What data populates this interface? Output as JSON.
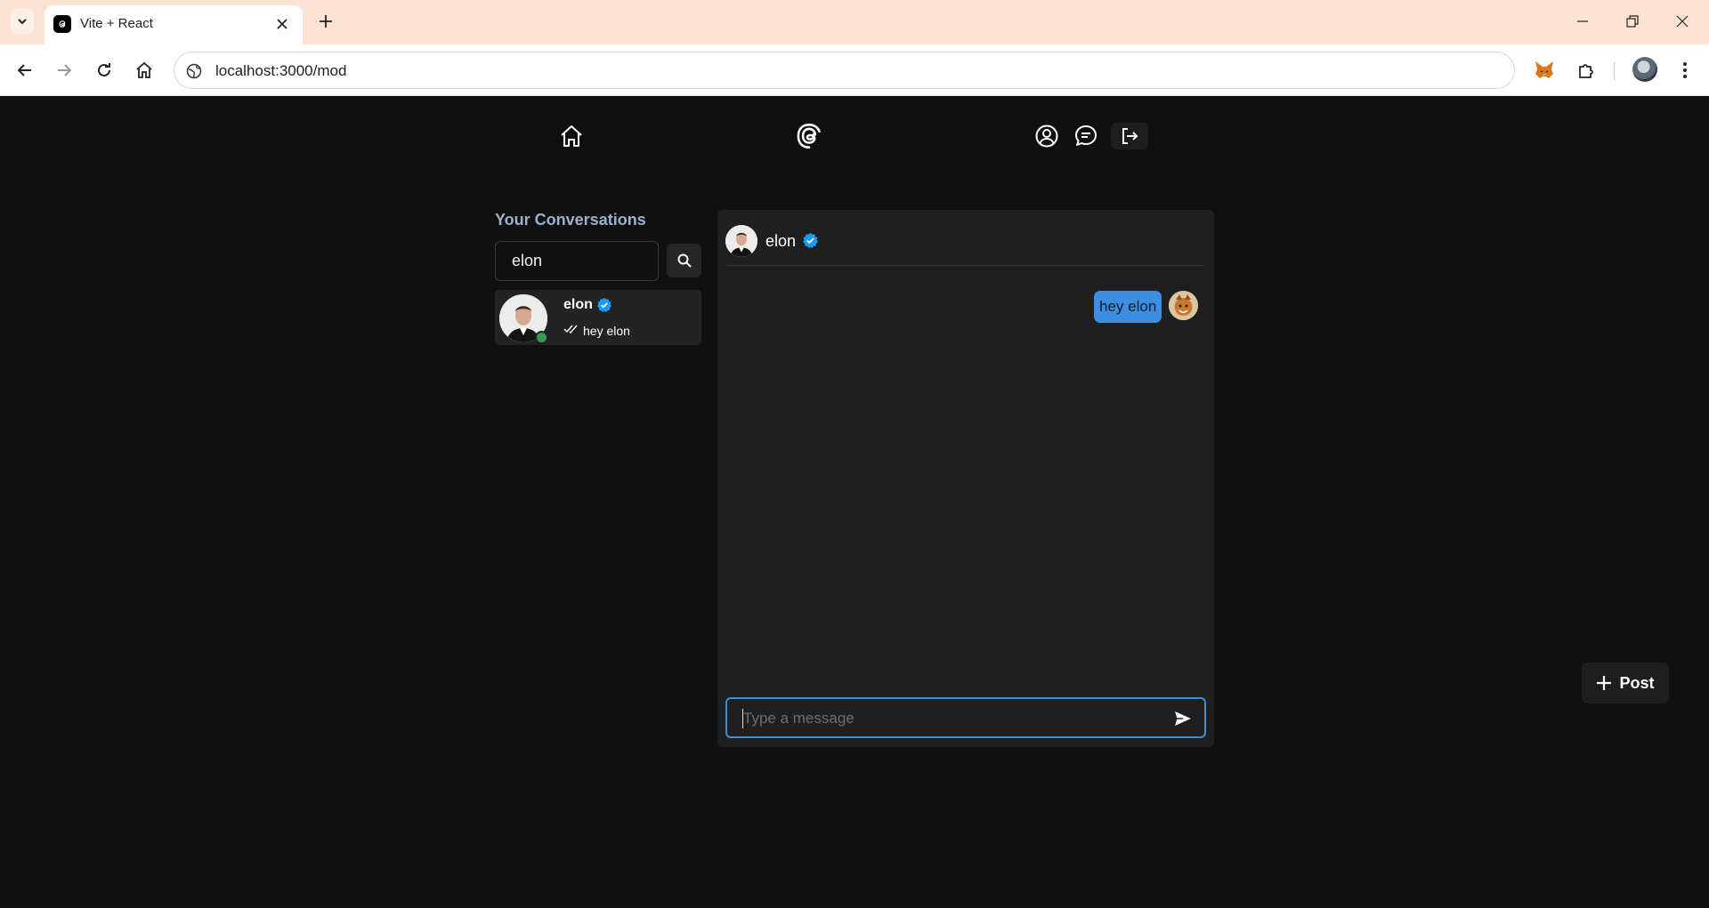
{
  "browser": {
    "tab_title": "Vite + React",
    "url": "localhost:3000/mod"
  },
  "icons": {
    "tab_list": "chevron-down-icon",
    "favicon": "threads-icon",
    "close": "close-icon",
    "new_tab": "plus-icon",
    "back": "arrow-left-icon",
    "forward": "arrow-right-icon",
    "reload": "reload-icon",
    "home": "home-icon",
    "site_info": "globe-icon",
    "extension_fox": "metamask-fox-icon",
    "extensions": "puzzle-icon",
    "menu": "kebab-menu-icon"
  },
  "nav": {
    "icons": [
      "home-icon",
      "threads-logo-icon",
      "user-icon",
      "chat-icon",
      "logout-icon"
    ]
  },
  "conversations": {
    "title": "Your Conversations",
    "search_value": "elon",
    "items": [
      {
        "name": "elon",
        "verified": true,
        "online": true,
        "last_message": "hey elon",
        "seen": true
      }
    ]
  },
  "chat": {
    "contact_name": "elon",
    "verified": true,
    "messages": [
      {
        "text": "hey elon",
        "own": true
      }
    ],
    "input_placeholder": "Type a message"
  },
  "post_button": {
    "label": "Post"
  },
  "colors": {
    "background": "#101010",
    "panel": "#1f1f1f",
    "accent": "#3c8fe0",
    "verified": "#1d9bf0",
    "online": "#2f9e55",
    "conversations_title": "#9db0cf"
  }
}
